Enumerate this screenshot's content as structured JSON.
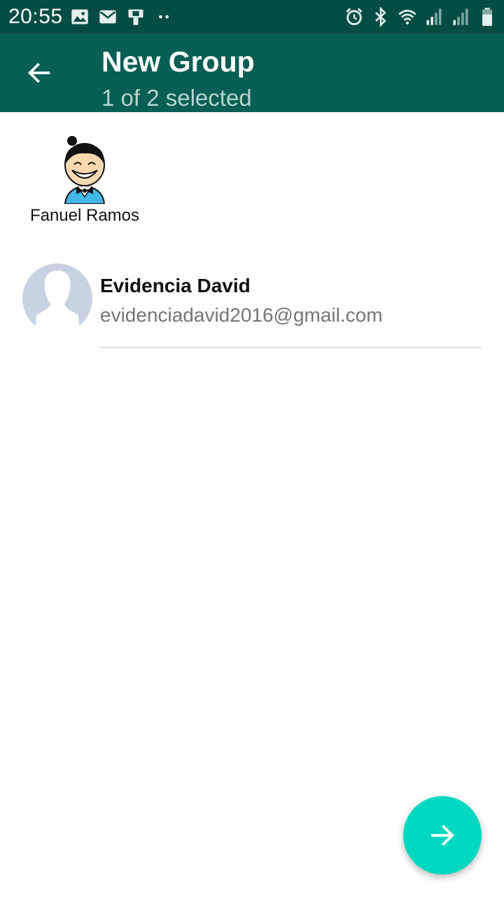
{
  "status_bar": {
    "time": "20:55",
    "left_icons": [
      "image-icon",
      "mail-icon",
      "device-icon",
      "more-dots-icon"
    ],
    "right_icons": [
      "alarm-icon",
      "bluetooth-icon",
      "wifi-icon",
      "signal-icon",
      "signal-icon",
      "battery-icon"
    ]
  },
  "app_bar": {
    "title": "New Group",
    "subtitle": "1 of 2 selected",
    "back_icon": "arrow-left-icon"
  },
  "selected": [
    {
      "name": "Fanuel Ramos",
      "avatar": "cartoon-boy-avatar"
    }
  ],
  "contacts": [
    {
      "name": "Evidencia David",
      "subtitle": "evidenciadavid2016@gmail.com",
      "avatar": "default-person-avatar"
    }
  ],
  "fab": {
    "icon": "arrow-right-icon"
  },
  "colors": {
    "status_bar": "#054d44",
    "app_bar": "#075e54",
    "fab": "#00d9c0",
    "avatar_placeholder": "#c8d2e2"
  }
}
